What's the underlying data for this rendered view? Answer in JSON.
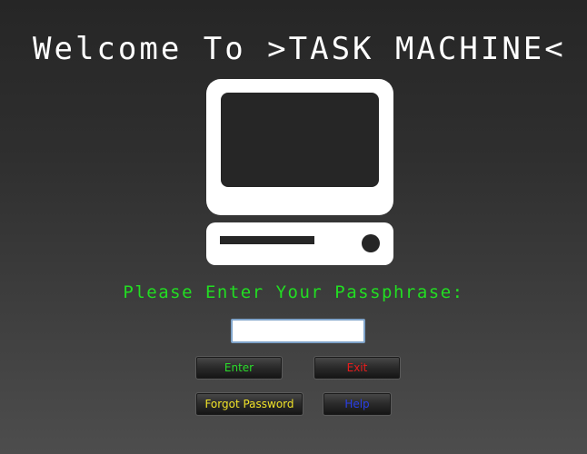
{
  "title": "Welcome To >TASK MACHINE<",
  "prompt": "Please Enter Your Passphrase:",
  "passphrase_field": {
    "value": "",
    "placeholder": ""
  },
  "buttons": {
    "enter": "Enter",
    "exit": "Exit",
    "forgot": "Forgot Password",
    "help": "Help"
  },
  "icon": "computer-icon",
  "colors": {
    "prompt": "#22dd22",
    "enter": "#2bdc2b",
    "exit": "#e81c1c",
    "forgot": "#f0e228",
    "help": "#2a3fe8"
  }
}
